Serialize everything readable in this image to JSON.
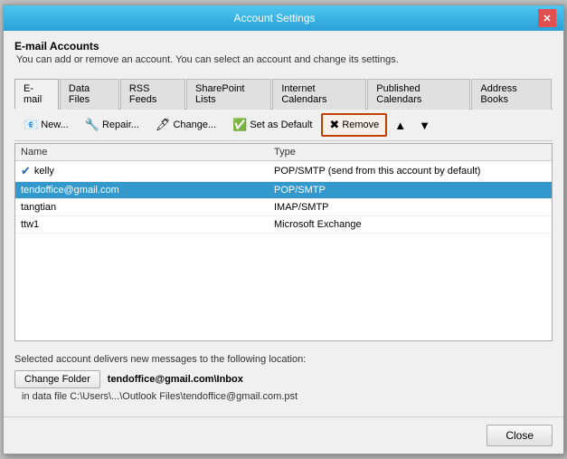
{
  "window": {
    "title": "Account Settings",
    "close_label": "✕"
  },
  "header": {
    "title": "E-mail Accounts",
    "description": "You can add or remove an account. You can select an account and change its settings."
  },
  "tabs": [
    {
      "label": "E-mail",
      "active": true
    },
    {
      "label": "Data Files",
      "active": false
    },
    {
      "label": "RSS Feeds",
      "active": false
    },
    {
      "label": "SharePoint Lists",
      "active": false
    },
    {
      "label": "Internet Calendars",
      "active": false
    },
    {
      "label": "Published Calendars",
      "active": false
    },
    {
      "label": "Address Books",
      "active": false
    }
  ],
  "toolbar": {
    "new_label": "New...",
    "repair_label": "Repair...",
    "change_label": "Change...",
    "set_default_label": "Set as Default",
    "remove_label": "Remove",
    "up_icon": "▲",
    "down_icon": "▼"
  },
  "table": {
    "col_name": "Name",
    "col_type": "Type",
    "rows": [
      {
        "name": "kelly",
        "type": "POP/SMTP (send from this account by default)",
        "default": true,
        "selected": false
      },
      {
        "name": "tendoffice@gmail.com",
        "type": "POP/SMTP",
        "default": false,
        "selected": true
      },
      {
        "name": "tangtian",
        "type": "IMAP/SMTP",
        "default": false,
        "selected": false
      },
      {
        "name": "ttw1",
        "type": "Microsoft Exchange",
        "default": false,
        "selected": false
      }
    ]
  },
  "bottom": {
    "deliver_text": "Selected account delivers new messages to the following location:",
    "change_folder_label": "Change Folder",
    "folder_name": "tendoffice@gmail.com\\Inbox",
    "folder_path": "in data file C:\\Users\\...\\Outlook Files\\tendoffice@gmail.com.pst"
  },
  "footer": {
    "close_label": "Close"
  }
}
